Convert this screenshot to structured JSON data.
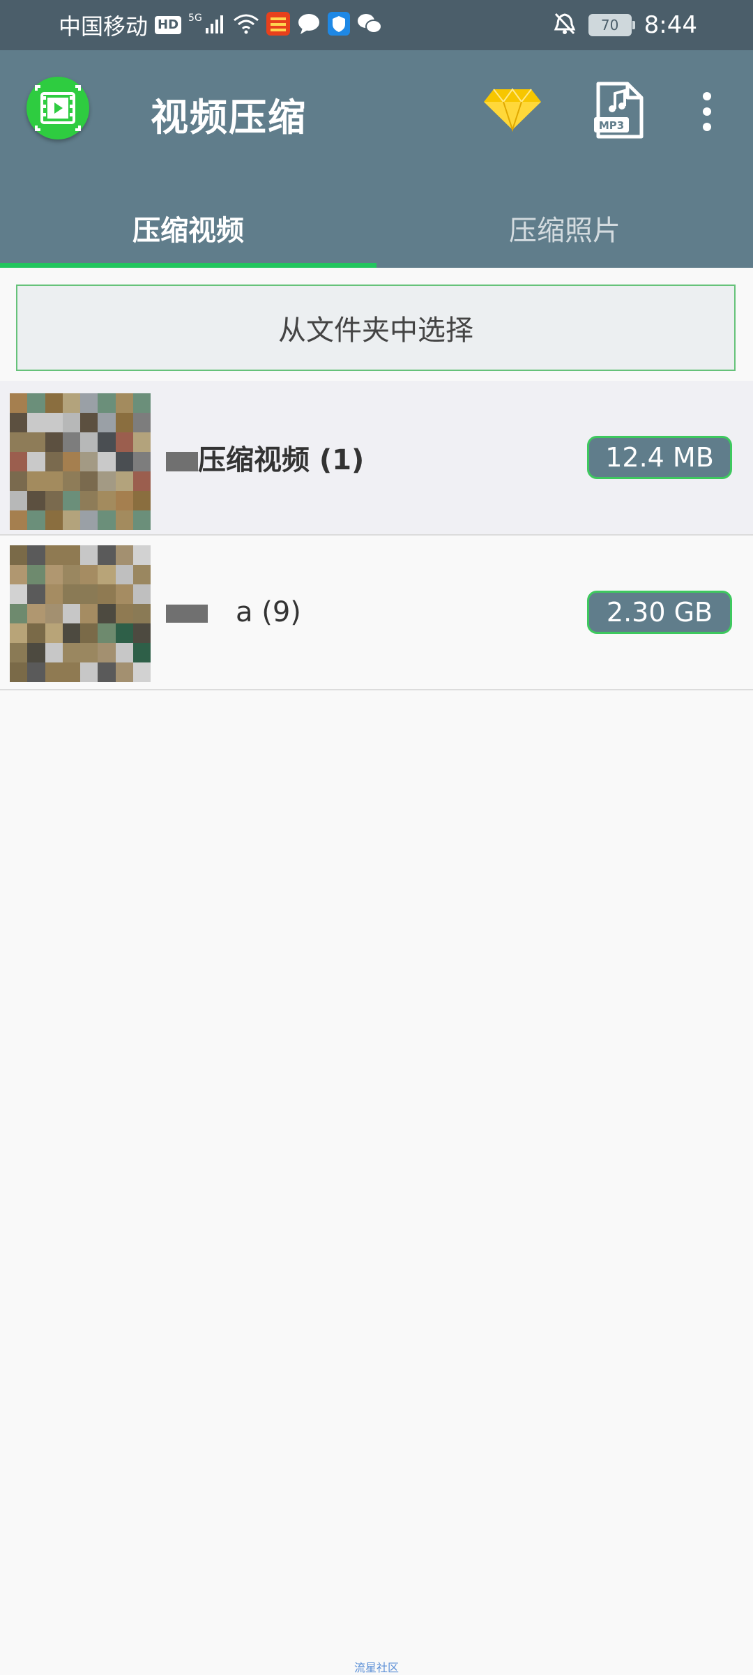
{
  "status_bar": {
    "carrier": "中国移动",
    "hd": "HD",
    "network": "5G",
    "battery": "70",
    "time": "8:44"
  },
  "app_bar": {
    "title": "视频压缩",
    "accent_color": "#607d8b",
    "logo_color": "#2ecc40",
    "mp3_label": "MP3"
  },
  "tabs": [
    {
      "label": "压缩视频",
      "active": true
    },
    {
      "label": "压缩照片",
      "active": false
    }
  ],
  "choose_button": {
    "label": "从文件夹中选择"
  },
  "folders": [
    {
      "name": "压缩视频 (1)",
      "size": "12.4 MB"
    },
    {
      "name": "a (9)",
      "size": "2.30 GB"
    }
  ],
  "watermark": "流星社区"
}
